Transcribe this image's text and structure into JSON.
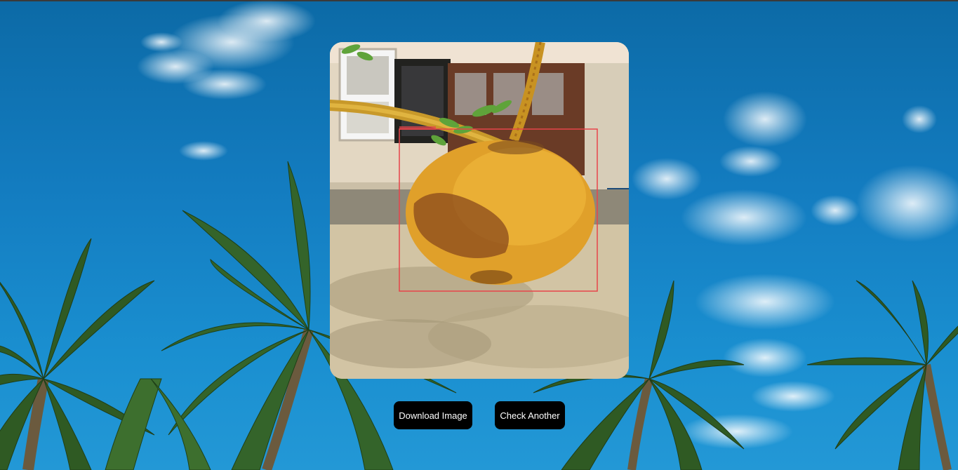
{
  "background": {
    "sky_color": "#137cc0",
    "description_icon": "palm-trees-sky"
  },
  "result": {
    "image_icon": "coconut-photo",
    "detection_box_color": "#e8444a",
    "detection_label": ""
  },
  "actions": {
    "download_label": "Download Image",
    "check_another_label": "Check Another"
  }
}
